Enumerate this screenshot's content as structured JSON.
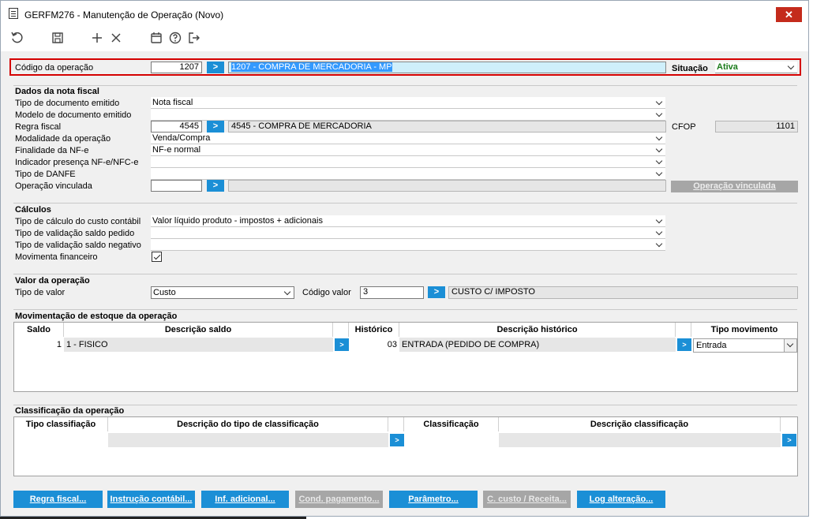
{
  "window": {
    "title": "GERFM276 - Manutenção de Operação (Novo)",
    "close": "✕"
  },
  "header": {
    "codigo_label": "Código da operação",
    "codigo_value": "1207",
    "codigo_desc": "1207 - COMPRA DE MERCADORIA - MP",
    "situacao_label": "Situação",
    "situacao_value": "Ativa"
  },
  "nota": {
    "title": "Dados da nota fiscal",
    "tipo_doc_label": "Tipo de documento emitido",
    "tipo_doc_value": "Nota fiscal",
    "modelo_label": "Modelo de documento emitido",
    "modelo_value": "",
    "regra_label": "Regra fiscal",
    "regra_value": "4545",
    "regra_desc": "4545 - COMPRA DE MERCADORIA",
    "cfop_label": "CFOP",
    "cfop_value": "1101",
    "modalidade_label": "Modalidade da operação",
    "modalidade_value": "Venda/Compra",
    "finalidade_label": "Finalidade da NF-e",
    "finalidade_value": "NF-e normal",
    "indicador_label": "Indicador presença NF-e/NFC-e",
    "indicador_value": "",
    "danfe_label": "Tipo de DANFE",
    "danfe_value": "",
    "vinculada_label": "Operação vinculada",
    "vinculada_value": "",
    "vinculada_desc": "",
    "vinculada_button": "Operação vinculada"
  },
  "calculos": {
    "title": "Cálculos",
    "custo_label": "Tipo de cálculo do custo contábil",
    "custo_value": "Valor líquido produto - impostos + adicionais",
    "saldo_pedido_label": "Tipo de validação saldo pedido",
    "saldo_pedido_value": "",
    "saldo_neg_label": "Tipo de validação saldo negativo",
    "saldo_neg_value": "",
    "financeiro_label": "Movimenta financeiro",
    "financeiro_checked": true
  },
  "valor": {
    "title": "Valor da operação",
    "tipo_label": "Tipo de valor",
    "tipo_value": "Custo",
    "codigo_label": "Código valor",
    "codigo_value": "3",
    "codigo_desc": "CUSTO C/ IMPOSTO"
  },
  "estoque": {
    "title": "Movimentação de estoque da operação",
    "headers": [
      "Saldo",
      "Descrição saldo",
      "Histórico",
      "Descrição histórico",
      "Tipo movimento"
    ],
    "rows": [
      {
        "saldo": "1",
        "desc_saldo": "1 - FISICO",
        "historico": "03",
        "desc_historico": "ENTRADA  (PEDIDO DE COMPRA)",
        "tipo": "Entrada"
      }
    ]
  },
  "classificacao": {
    "title": "Classificação da operação",
    "headers": [
      "Tipo classifiação",
      "Descrição do tipo de classificação",
      "Classificação",
      "Descrição classificação"
    ]
  },
  "buttons": {
    "regra": "Regra fiscal...",
    "instrucao": "Instrução contábil...",
    "inf": "Inf. adicional...",
    "cond": "Cond. pagamento...",
    "parametro": "Parâmetro...",
    "ccusto": "C. custo / Receita...",
    "log": "Log alteração..."
  },
  "go_glyph": ">"
}
